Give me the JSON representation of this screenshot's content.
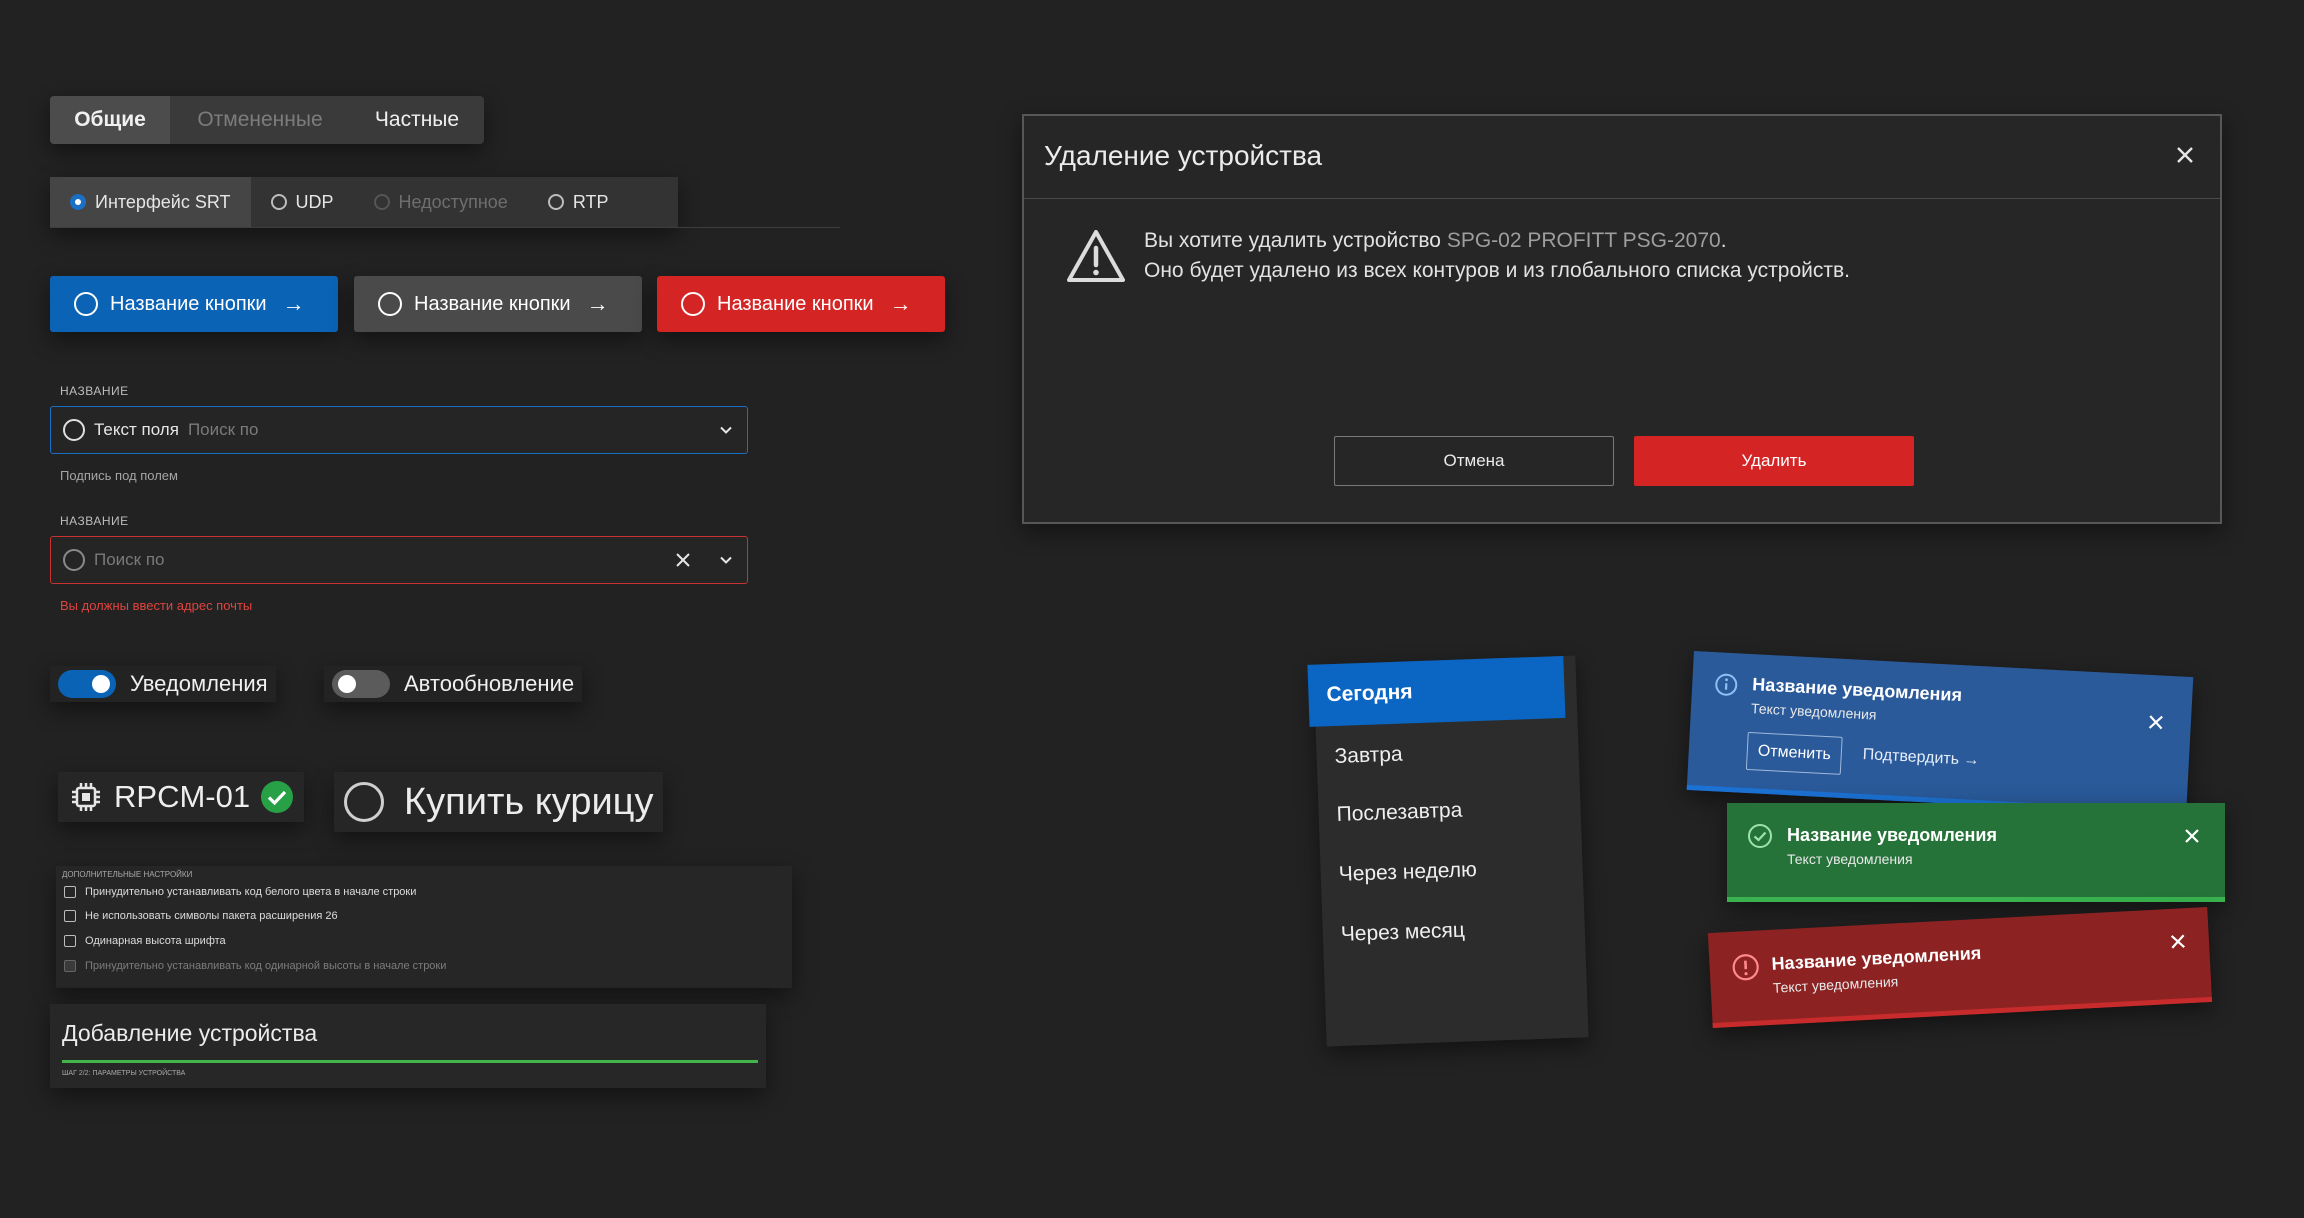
{
  "tabs": {
    "items": [
      {
        "label": "Общие",
        "state": "active"
      },
      {
        "label": "Отмененные",
        "state": "muted"
      },
      {
        "label": "Частные",
        "state": "normal"
      }
    ]
  },
  "radio_group": {
    "items": [
      {
        "label": "Интерфейс SRT",
        "state": "selected"
      },
      {
        "label": "UDP",
        "state": "normal"
      },
      {
        "label": "Недоступное",
        "state": "disabled"
      },
      {
        "label": "RTP",
        "state": "normal"
      }
    ]
  },
  "buttons": {
    "primary_label": "Название кнопки",
    "secondary_label": "Название кнопки",
    "danger_label": "Название кнопки",
    "colors": {
      "primary": "#0b63b5",
      "secondary": "#4a4a4a",
      "danger": "#d42424"
    }
  },
  "field1": {
    "label": "НАЗВАНИЕ",
    "value": "Текст поля",
    "placeholder": "Поиск по",
    "hint": "Подпись под полем",
    "border_color": "#1b6fc4"
  },
  "field2": {
    "label": "НАЗВАНИЕ",
    "placeholder": "Поиск по",
    "error": "Вы должны ввести адрес почты",
    "border_color": "#c83232"
  },
  "toggles": {
    "notifications": {
      "label": "Уведомления",
      "on": true
    },
    "autoupdate": {
      "label": "Автообновление",
      "on": false
    }
  },
  "device_chip": {
    "label": "RPCM-01",
    "icon": "chip-icon",
    "status_icon": "check-circle-icon"
  },
  "task_chip": {
    "label": "Купить курицу"
  },
  "settings": {
    "header": "ДОПОЛНИТЕЛЬНЫЕ НАСТРОЙКИ",
    "items": [
      {
        "label": "Принудительно устанавливать код белого цвета в начале строки",
        "disabled": false
      },
      {
        "label": "Не использовать символы пакета расширения 26",
        "disabled": false
      },
      {
        "label": "Одинарная высота шрифта",
        "disabled": false
      },
      {
        "label": "Принудительно устанавливать код одинарной высоты в начале строки",
        "disabled": true
      }
    ]
  },
  "add_device": {
    "title": "Добавление устройства",
    "step": "ШАГ 2/2: ПАРАМЕТРЫ УСТРОЙСТВА",
    "progress_color": "#3fb54a"
  },
  "dialog": {
    "title": "Удаление устройства",
    "message_prefix": "Вы хотите удалить устройство",
    "device": "SPG-02 PROFITT PSG-2070",
    "message_suffix": ".",
    "message_line2": "Оно будет удалено из всех контуров и из глобального списка устройств.",
    "cancel_label": "Отмена",
    "delete_label": "Удалить"
  },
  "menu": {
    "items": [
      {
        "label": "Сегодня",
        "selected": true
      },
      {
        "label": "Завтра",
        "selected": false
      },
      {
        "label": "Послезавтра",
        "selected": false
      },
      {
        "label": "Через неделю",
        "selected": false
      },
      {
        "label": "Через месяц",
        "selected": false
      }
    ]
  },
  "notifications": {
    "info": {
      "title": "Название уведомления",
      "text": "Текст уведомления",
      "cancel_label": "Отменить",
      "confirm_label": "Подтвердить →"
    },
    "success": {
      "title": "Название уведомления",
      "text": "Текст уведомления"
    },
    "error": {
      "title": "Название уведомления",
      "text": "Текст уведомления"
    }
  }
}
